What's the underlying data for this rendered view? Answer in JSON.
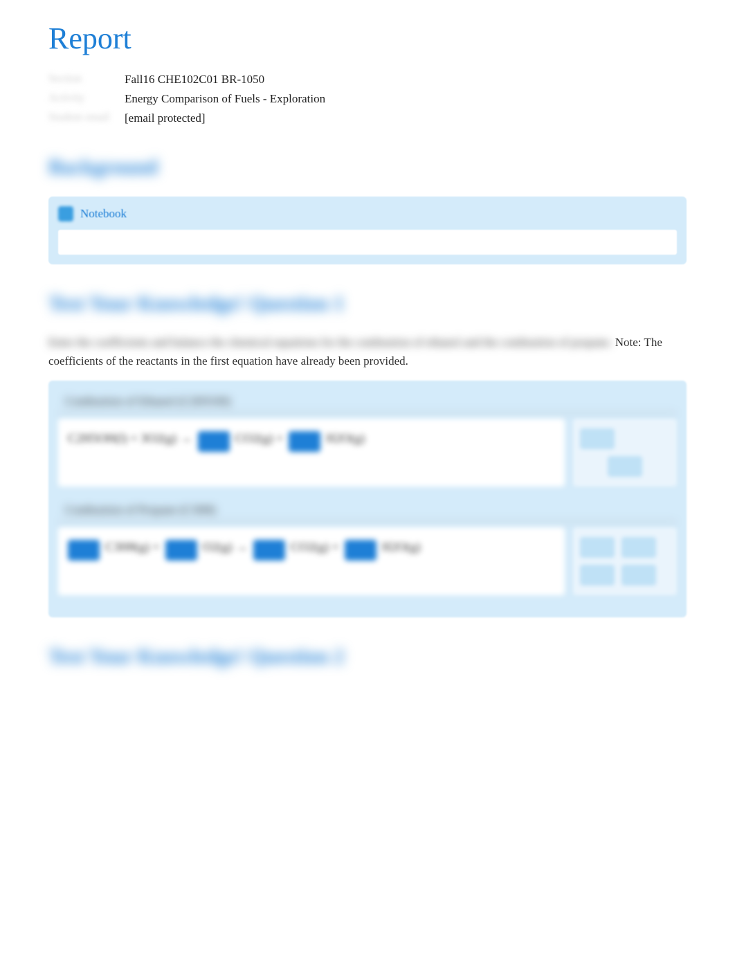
{
  "title": "Report",
  "meta": {
    "rows": [
      {
        "label": "Section",
        "value": "Fall16 CHE102C01 BR-1050"
      },
      {
        "label": "Activity",
        "value": "Energy Comparison of Fuels - Exploration"
      },
      {
        "label": "Student email",
        "value": "[email protected]"
      }
    ]
  },
  "sections": {
    "background_heading": "Background",
    "notebook_label": "Notebook",
    "q1_heading": "Test Your Knowledge! Question 1",
    "q1_instruction_blur": "Enter the coefficients and balance the chemical equations for the combustion of ethanol and the combustion of propane.",
    "q1_instruction_clear": " Note: The coefficients of the reactants in the first equation have already been provided.",
    "eq1_title": "Combustion of Ethanol (C2H5OH)",
    "eq1_text_a": "C2H5OH(l) + 3O2(g) →",
    "eq1_text_b": "CO2(g) +",
    "eq1_text_c": "H2O(g)",
    "eq2_title": "Combustion of Propane (C3H8)",
    "eq2_text_a": "C3H8(g) +",
    "eq2_text_b": "O2(g) →",
    "eq2_text_c": "CO2(g) +",
    "eq2_text_d": "H2O(g)",
    "q2_heading": "Test Your Knowledge! Question 2"
  }
}
